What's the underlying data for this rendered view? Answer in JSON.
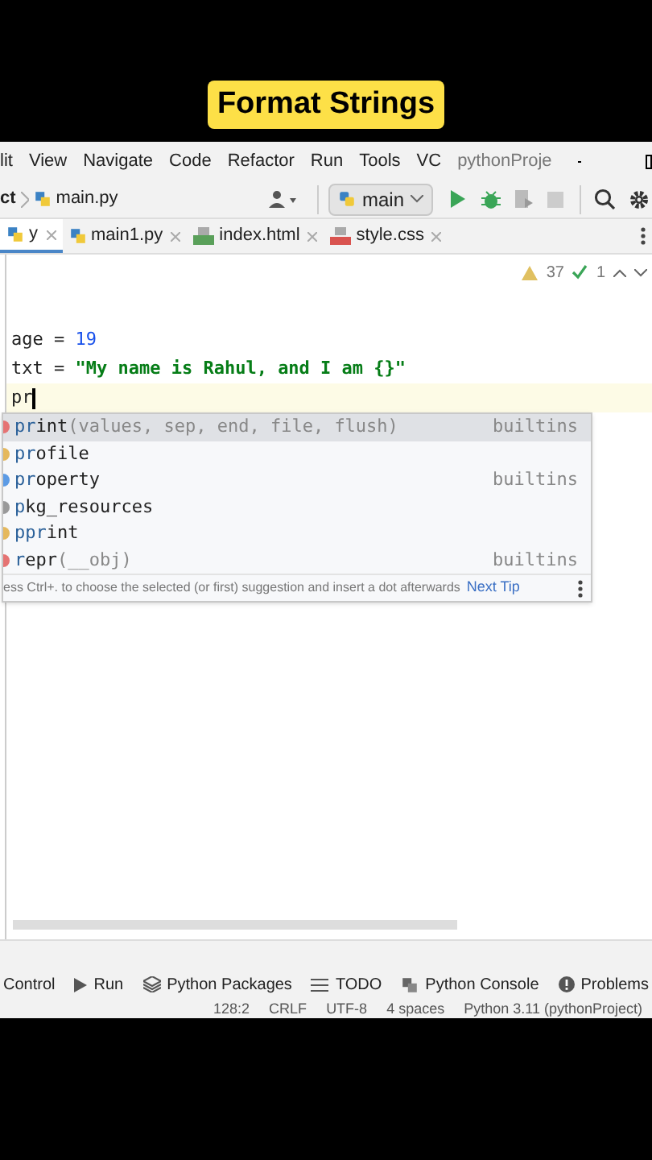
{
  "banner": {
    "title": "Format Strings"
  },
  "menu": [
    "lit",
    "View",
    "Navigate",
    "Code",
    "Refactor",
    "Run",
    "Tools",
    "VC",
    "pythonProje"
  ],
  "breadcrumb": {
    "project": "ct",
    "file": "main.py"
  },
  "run_config": {
    "label": "main"
  },
  "tabs": [
    {
      "label": "y",
      "kind": "python",
      "selected": true
    },
    {
      "label": "main1.py",
      "kind": "python",
      "selected": false
    },
    {
      "label": "index.html",
      "kind": "html",
      "selected": false
    },
    {
      "label": "style.css",
      "kind": "css",
      "selected": false
    }
  ],
  "inspections": {
    "warnings": "37",
    "weak_warnings": "1"
  },
  "code": [
    {
      "kind": "assign_num",
      "name": "age",
      "op": "=",
      "value": "19",
      "current": false
    },
    {
      "kind": "assign_str",
      "name": "txt",
      "op": "=",
      "value": "\"My name is Rahul, and I am {}\"",
      "current": false
    },
    {
      "kind": "typing",
      "text": "pr",
      "current": true
    }
  ],
  "completion": {
    "items": [
      {
        "match": "pr",
        "rest": "int",
        "params": "(values, sep, end, file, flush)",
        "source": "builtins",
        "kind": "function",
        "selected": true
      },
      {
        "match": "pr",
        "rest": "ofile",
        "kind": "module",
        "selected": false
      },
      {
        "match": "pr",
        "rest": "operty",
        "source": "builtins",
        "kind": "class",
        "selected": false
      },
      {
        "match": "p",
        "rest": "kg_resources",
        "kind": "package",
        "selected": false
      },
      {
        "match": "ppr",
        "rest": "int",
        "kind": "module",
        "selected": false
      },
      {
        "match": "r",
        "rest": "epr",
        "params": "(__obj)",
        "source": "builtins",
        "kind": "function",
        "selected": false
      }
    ],
    "hint": "ess Ctrl+. to choose the selected (or first) suggestion and insert a dot afterwards",
    "tip_link": "Next Tip"
  },
  "tool_windows": [
    {
      "label": "Control",
      "kind": "none"
    },
    {
      "label": "Run",
      "kind": "run"
    },
    {
      "label": "Python Packages",
      "kind": "packages"
    },
    {
      "label": "TODO",
      "kind": "todo"
    },
    {
      "label": "Python Console",
      "kind": "console"
    },
    {
      "label": "Problems",
      "kind": "problems"
    }
  ],
  "status_bar": [
    "128:2",
    "CRLF",
    "UTF-8",
    "4 spaces",
    "Python 3.11 (pythonProject)"
  ]
}
